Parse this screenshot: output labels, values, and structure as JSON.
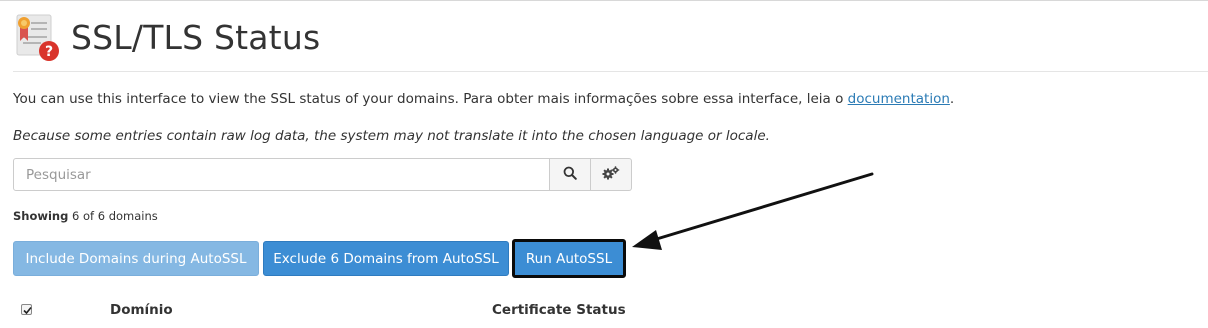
{
  "page": {
    "title": "SSL/TLS Status",
    "intro_text": "You can use this interface to view the SSL status of your domains. Para obter mais informações sobre essa interface, leia o ",
    "intro_link": "documentation",
    "intro_end": ".",
    "note": "Because some entries contain raw log data, the system may not translate it into the chosen language or locale."
  },
  "search": {
    "placeholder": "Pesquisar",
    "search_icon": "search-icon",
    "settings_icon": "gears-icon"
  },
  "showing": {
    "label": "Showing",
    "text": "6 of 6 domains"
  },
  "buttons": {
    "include": "Include Domains during AutoSSL",
    "exclude": "Exclude 6 Domains from AutoSSL",
    "run": "Run AutoSSL"
  },
  "table": {
    "columns": [
      "Domínio",
      "Certificate Status"
    ],
    "select_all_checked": true
  },
  "colors": {
    "primary": "#3c8dd4",
    "disabled": "#85b8e3",
    "link": "#2b7bb5",
    "highlight_border": "#0a0a0a"
  }
}
